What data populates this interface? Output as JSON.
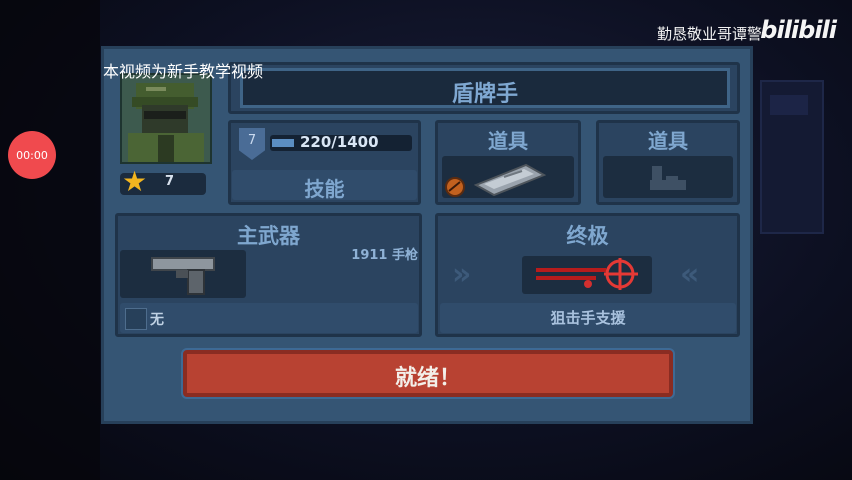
{
  "watermark": {
    "uploader": "勤恳敬业哥谭警",
    "logo": "bilibili"
  },
  "overlay_caption": "本视频为新手教学视频",
  "recorder": {
    "time": "00:00"
  },
  "character": {
    "name": "盾牌手",
    "rank": "7",
    "xp": "220/1400",
    "xp_fraction": 0.157,
    "stars": "7"
  },
  "slots": {
    "skill_label": "技能",
    "item1_label": "道具",
    "item2_label": "道具",
    "primary_label": "主武器",
    "primary_weapon": "1911 手枪",
    "secondary_none": "无",
    "ultimate_label": "终极",
    "ultimate_name": "狙击手支援"
  },
  "ready_button": "就绪！",
  "colors": {
    "panel": "#355574",
    "ready": "#b84232",
    "star": "#f3b51f",
    "label": "#7fa7cf"
  }
}
